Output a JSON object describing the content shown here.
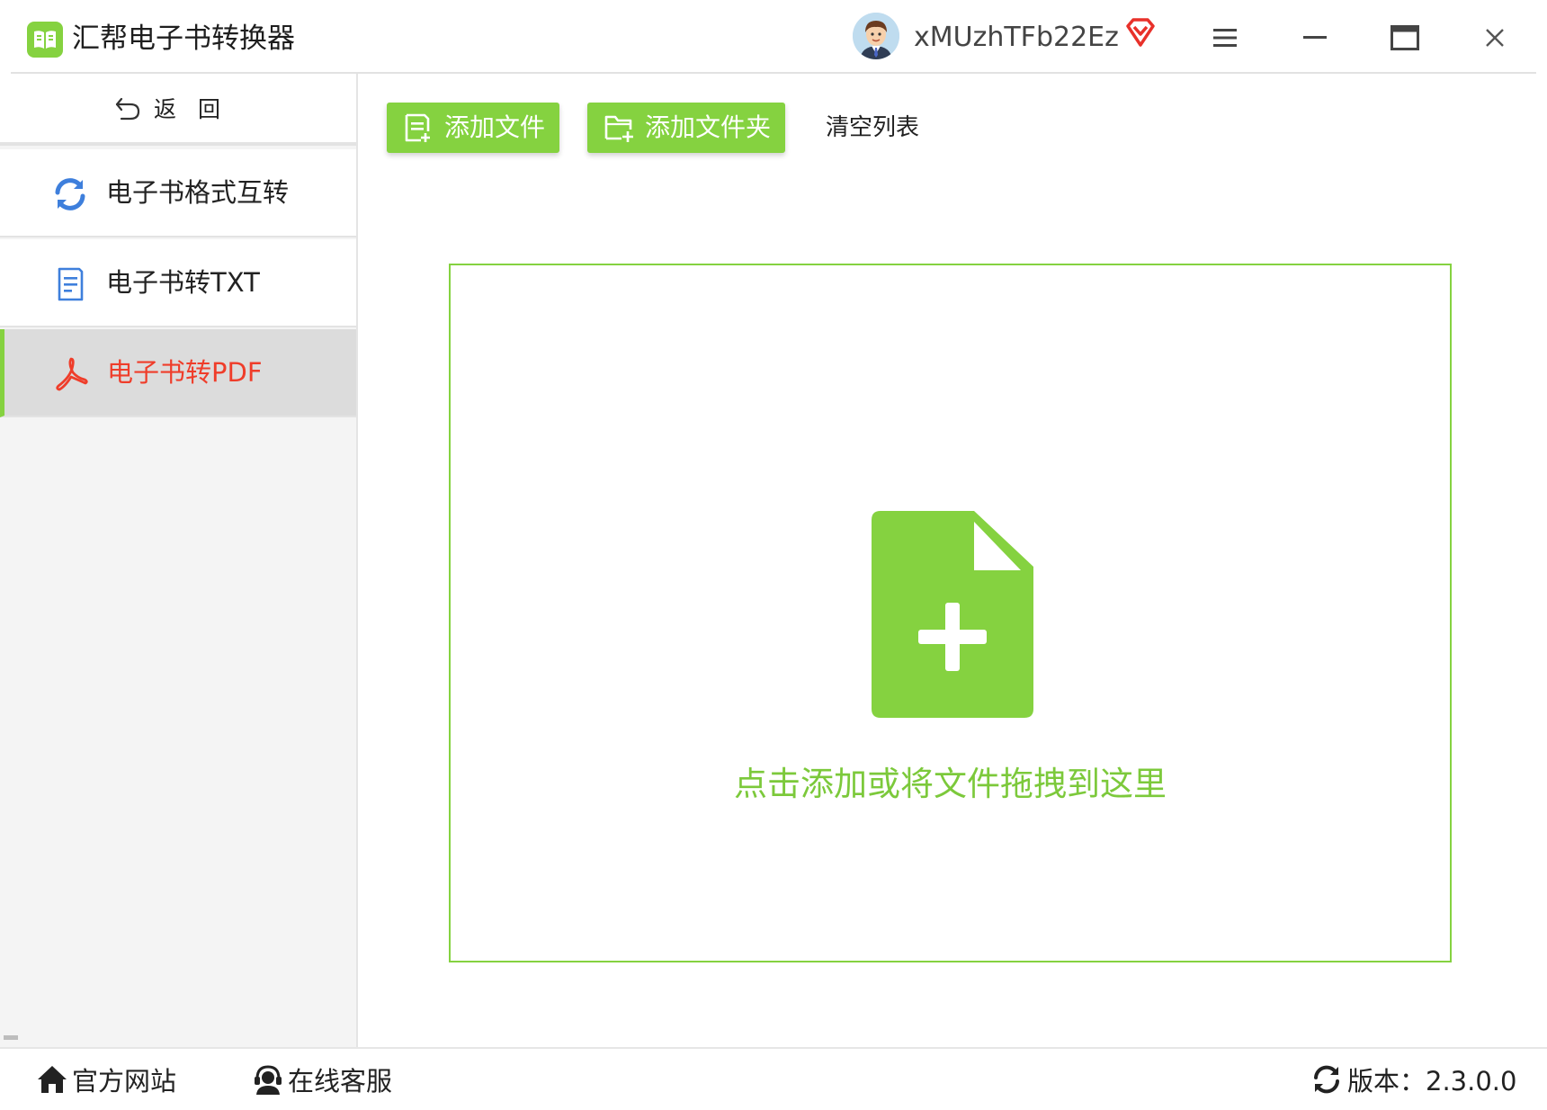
{
  "app": {
    "title": "汇帮电子书转换器",
    "accent_color": "#85d240",
    "active_text_color": "#ef3d2a"
  },
  "user": {
    "name": "xMUzhTFb22Ez",
    "avatar_icon": "avatar-icon",
    "vip_icon": "vip-diamond-icon"
  },
  "window_controls": [
    "menu-icon",
    "minimize-icon",
    "maximize-icon",
    "close-icon"
  ],
  "sidebar": {
    "back_label": "返回",
    "items": [
      {
        "label": "电子书格式互转",
        "icon": "refresh-icon",
        "active": false
      },
      {
        "label": "电子书转TXT",
        "icon": "document-icon",
        "active": false
      },
      {
        "label": "电子书转PDF",
        "icon": "pdf-icon",
        "active": true
      }
    ]
  },
  "toolbar": {
    "add_file_label": "添加文件",
    "add_folder_label": "添加文件夹",
    "clear_list_label": "清空列表"
  },
  "drop_zone": {
    "hint": "点击添加或将文件拖拽到这里",
    "icon": "file-add-icon"
  },
  "statusbar": {
    "website_label": "官方网站",
    "support_label": "在线客服",
    "version_label": "版本：2.3.0.0"
  }
}
